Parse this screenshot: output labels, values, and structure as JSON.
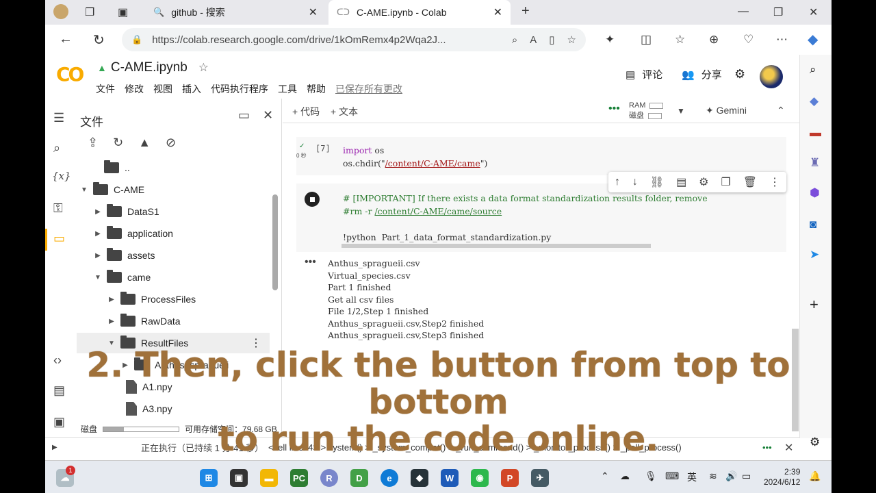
{
  "browser": {
    "tabs": [
      {
        "title": "github - 搜索",
        "icon": "search-icon"
      },
      {
        "title": "C-AME.ipynb - Colab",
        "icon": "colab-icon"
      }
    ],
    "url": "https://colab.research.google.com/drive/1kOmRemx4p2Wqa2J..."
  },
  "colab": {
    "logo": "CO",
    "notebook_title": "C-AME.ipynb",
    "menu": [
      "文件",
      "修改",
      "视图",
      "插入",
      "代码执行程序",
      "工具",
      "帮助"
    ],
    "saved_status": "已保存所有更改",
    "comment_label": "评论",
    "share_label": "分享"
  },
  "files_panel": {
    "title": "文件",
    "tree": [
      {
        "label": "..",
        "type": "folder",
        "caret": ""
      },
      {
        "label": "C-AME",
        "type": "folder",
        "caret": "▼"
      },
      {
        "label": "DataS1",
        "type": "folder",
        "caret": "▶"
      },
      {
        "label": "application",
        "type": "folder",
        "caret": "▶"
      },
      {
        "label": "assets",
        "type": "folder",
        "caret": "▶"
      },
      {
        "label": "came",
        "type": "folder",
        "caret": "▼"
      },
      {
        "label": "ProcessFiles",
        "type": "folder",
        "caret": "▶"
      },
      {
        "label": "RawData",
        "type": "folder",
        "caret": "▶"
      },
      {
        "label": "ResultFiles",
        "type": "folder",
        "caret": "▼"
      },
      {
        "label": "Anthus_spragueii",
        "type": "folder",
        "caret": "▶"
      },
      {
        "label": "A1.npy",
        "type": "file",
        "caret": ""
      },
      {
        "label": "A3.npy",
        "type": "file",
        "caret": ""
      }
    ],
    "disk_label": "磁盘",
    "disk_used_fraction": 0.27,
    "disk_free": "可用存储空间：79.68 GB"
  },
  "toolbar": {
    "add_code": "+ 代码",
    "add_text": "+ 文本",
    "ram_label": "RAM",
    "disk_label": "磁盘",
    "gemini_label": "Gemini"
  },
  "cells": {
    "cell1": {
      "exec_count": "[7]",
      "exec_time": "0 秒",
      "line1_kw": "import",
      "line1_rest": " os",
      "line2_a": "os.chdir(\"",
      "line2_str": "/content/C-AME/came",
      "line2_b": "\")"
    },
    "cell2": {
      "comment": "# [IMPORTANT] If there exists a data format standardization results folder, remove",
      "rm_cmd": "#rm -r ",
      "rm_path": "/content/C-AME/came/source",
      "run_cmd": "!python  Part_1_data_format_standardization.py"
    },
    "output_lines": [
      "Anthus_spragueii.csv",
      "Virtual_species.csv",
      "Part 1 finished",
      "Get all csv files",
      "File 1/2,Step 1 finished",
      "Anthus_spragueii.csv,Step2 finished",
      "Anthus_spragueii.csv,Step3 finished"
    ]
  },
  "statusbar": {
    "status": "正在执行（已持续 1 分 41 秒）",
    "trace": "<cell line: 4> > system() > _system_compat() > _run_command() > _monitor_process() > _poll_process()"
  },
  "overlay": {
    "line1": "2. Then, click the button from top to bottom",
    "line2": "to run the code online."
  },
  "taskbar": {
    "notification_count": "1",
    "ime": "英",
    "time": "2:39",
    "date": "2024/6/12"
  }
}
